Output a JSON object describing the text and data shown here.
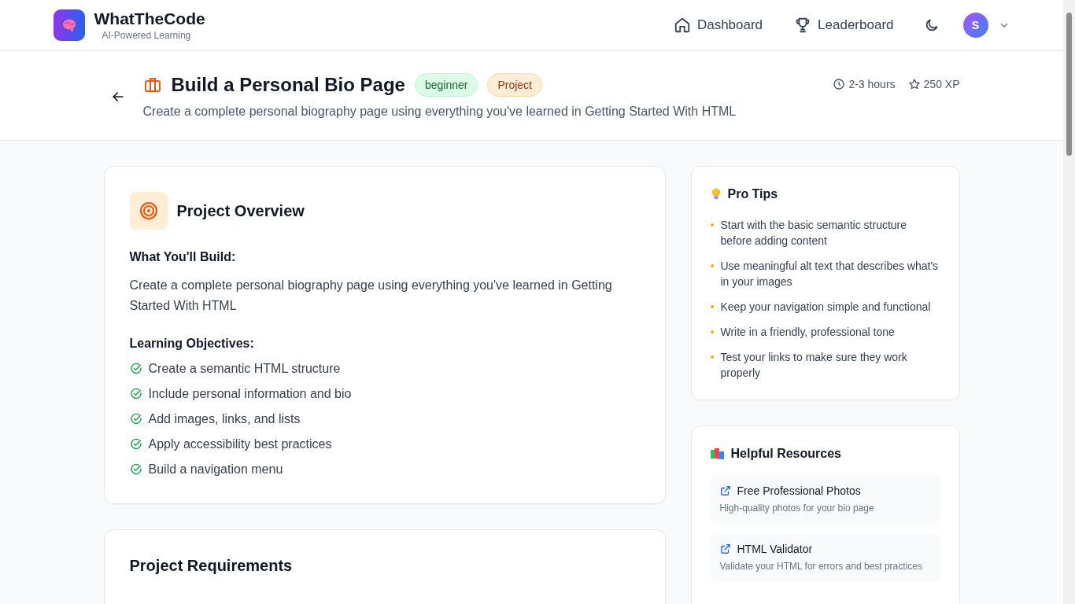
{
  "header": {
    "logo_title": "WhatTheCode",
    "logo_subtitle": "AI-Powered Learning",
    "nav": [
      {
        "label": "Dashboard",
        "kind": "home"
      },
      {
        "label": "Leaderboard",
        "kind": "trophy"
      }
    ],
    "avatar": "S"
  },
  "project": {
    "title": "Build a Personal Bio Page",
    "badges": [
      {
        "label": "beginner",
        "kind": "level"
      },
      {
        "label": "Project",
        "kind": "type"
      }
    ],
    "description": "Create a complete personal biography page using everything you've learned in Getting Started With HTML",
    "duration": "2-3 hours",
    "xp": "250 XP"
  },
  "overview": {
    "title": "Project Overview",
    "build_heading": "What You'll Build:",
    "build_text": "Create a complete personal biography page using everything you've learned in Getting Started With HTML",
    "objectives_heading": "Learning Objectives:",
    "objectives": [
      "Create a semantic HTML structure",
      "Include personal information and bio",
      "Add images, links, and lists",
      "Apply accessibility best practices",
      "Build a navigation menu"
    ]
  },
  "requirements": {
    "title": "Project Requirements"
  },
  "tips": {
    "title": "Pro Tips",
    "items": [
      "Start with the basic semantic structure before adding content",
      "Use meaningful alt text that describes what's in your images",
      "Keep your navigation simple and functional",
      "Write in a friendly, professional tone",
      "Test your links to make sure they work properly"
    ]
  },
  "resources": {
    "title": "Helpful Resources",
    "items": [
      {
        "title": "Free Professional Photos",
        "description": "High-quality photos for your bio page"
      },
      {
        "title": "HTML Validator",
        "description": "Validate your HTML for errors and best practices"
      }
    ]
  }
}
